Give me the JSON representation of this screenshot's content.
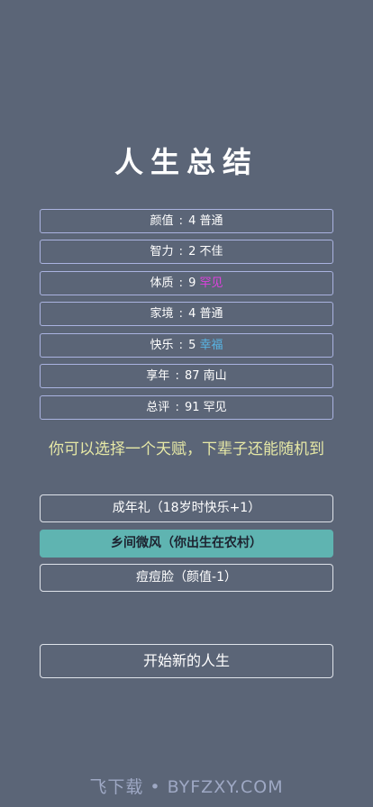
{
  "title": "人生总结",
  "stats": [
    {
      "label": "颜值",
      "value": "4",
      "grade": "普通",
      "grade_color": "#ffffff"
    },
    {
      "label": "智力",
      "value": "2",
      "grade": "不佳",
      "grade_color": "#ffffff"
    },
    {
      "label": "体质",
      "value": "9",
      "grade": "罕见",
      "grade_color": "#e040e0"
    },
    {
      "label": "家境",
      "value": "4",
      "grade": "普通",
      "grade_color": "#ffffff"
    },
    {
      "label": "快乐",
      "value": "5",
      "grade": "幸福",
      "grade_color": "#58b6e6"
    },
    {
      "label": "享年",
      "value": "87",
      "grade": "南山",
      "grade_color": "#ffffff"
    },
    {
      "label": "总评",
      "value": "91",
      "grade": "罕见",
      "grade_color": "#ffffff"
    }
  ],
  "separator": ":",
  "prompt": "你可以选择一个天赋，下辈子还能随机到",
  "talents": [
    {
      "label": "成年礼（18岁时快乐+1）",
      "selected": false
    },
    {
      "label": "乡间微风（你出生在农村）",
      "selected": true
    },
    {
      "label": "痘痘脸（颜值-1）",
      "selected": false
    }
  ],
  "restart_label": "开始新的人生",
  "watermark": "飞下载 • BYFZXY.COM",
  "colors": {
    "background": "#5b6577",
    "stat_border": "#aab3e0",
    "prompt_text": "#e6e8a6",
    "selected_talent_bg": "#5fb4b1",
    "watermark": "#9ea8c4"
  }
}
